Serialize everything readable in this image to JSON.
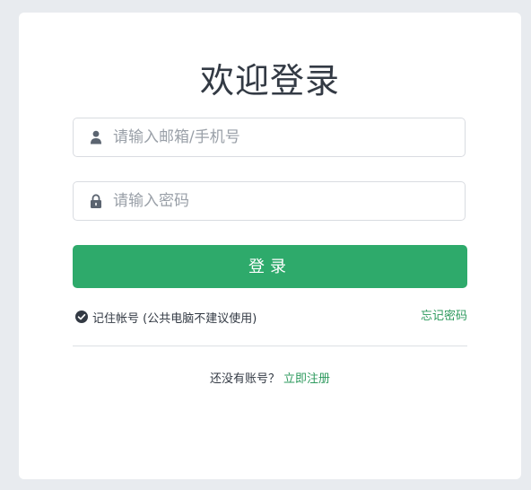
{
  "login": {
    "title": "欢迎登录",
    "username": {
      "value": "",
      "placeholder": "请输入邮箱/手机号",
      "icon": "user-icon"
    },
    "password": {
      "value": "",
      "placeholder": "请输入密码",
      "icon": "lock-icon"
    },
    "submit_label": "登录",
    "remember_label": "记住帐号 (公共电脑不建议使用)",
    "remember_checked": true,
    "forgot_label": "忘记密码",
    "no_account_text": "还没有账号？",
    "register_label": "立即注册"
  },
  "colors": {
    "accent": "#2eaa6b",
    "link": "#2e9a5e",
    "background": "#e8ebef",
    "text": "#333a44"
  }
}
